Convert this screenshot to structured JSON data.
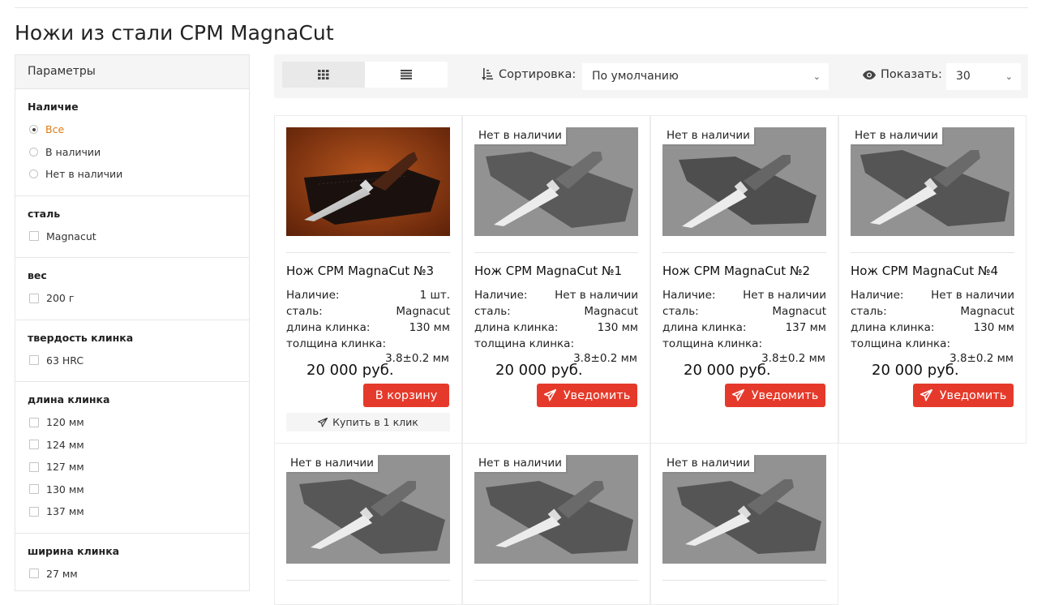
{
  "page": {
    "title": "Ножи из стали CPM MagnaCut"
  },
  "sidebar": {
    "header": "Параметры",
    "groups": [
      {
        "title": "Наличие",
        "type": "radio",
        "options": [
          "Все",
          "В наличии",
          "Нет в наличии"
        ],
        "selected": 0
      },
      {
        "title": "сталь",
        "type": "checkbox",
        "options": [
          "Magnacut"
        ]
      },
      {
        "title": "вес",
        "type": "checkbox",
        "options": [
          "200 г"
        ]
      },
      {
        "title": "твердость клинка",
        "type": "checkbox",
        "options": [
          "63 HRC"
        ]
      },
      {
        "title": "длина клинка",
        "type": "checkbox",
        "options": [
          "120 мм",
          "124 мм",
          "127 мм",
          "130 мм",
          "137 мм"
        ]
      },
      {
        "title": "ширина клинка",
        "type": "checkbox",
        "options": [
          "27 мм"
        ]
      }
    ]
  },
  "toolbar": {
    "sort_label": "Сортировка:",
    "sort_value": "По умолчанию",
    "show_label": "Показать:",
    "show_value": "30"
  },
  "labels": {
    "availability": "Наличие:",
    "steel": "сталь:",
    "blade_length": "длина клинка:",
    "blade_thickness": "толщина клинка:",
    "out_of_stock_badge": "Нет в наличии",
    "cart_button": "В корзину",
    "notify_button": "Уведомить",
    "one_click": "Купить в 1 клик"
  },
  "products": [
    {
      "name": "Нож CPM MagnaCut №3",
      "availability": "1 шт.",
      "steel": "Magnacut",
      "length": "130 мм",
      "thickness": "3.8±0.2 мм",
      "price": "20 000 руб.",
      "in_stock": true
    },
    {
      "name": "Нож CPM MagnaCut №1",
      "availability": "Нет в наличии",
      "steel": "Magnacut",
      "length": "130 мм",
      "thickness": "3.8±0.2 мм",
      "price": "20 000 руб.",
      "in_stock": false
    },
    {
      "name": "Нож CPM MagnaCut №2",
      "availability": "Нет в наличии",
      "steel": "Magnacut",
      "length": "137 мм",
      "thickness": "3.8±0.2 мм",
      "price": "20 000 руб.",
      "in_stock": false
    },
    {
      "name": "Нож CPM MagnaCut №4",
      "availability": "Нет в наличии",
      "steel": "Magnacut",
      "length": "130 мм",
      "thickness": "3.8±0.2 мм",
      "price": "20 000 руб.",
      "in_stock": false
    },
    {
      "in_stock": false
    },
    {
      "in_stock": false
    },
    {
      "in_stock": false
    }
  ],
  "colors": {
    "accent": "#e53a2b",
    "active_filter": "#e07a10",
    "toolbar_bg": "#f5f5f5"
  }
}
